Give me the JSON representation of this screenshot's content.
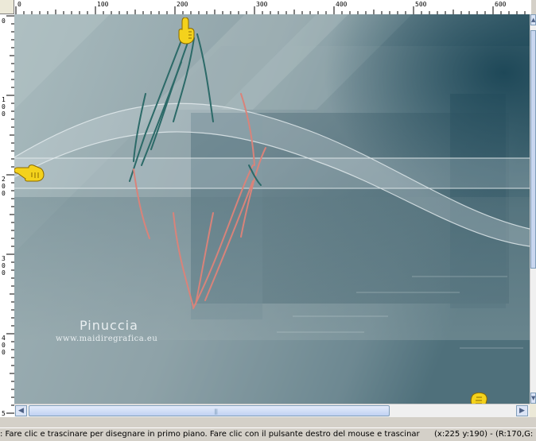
{
  "ruler_top": {
    "labels": [
      "0",
      "100",
      "200",
      "300",
      "400",
      "500",
      "600"
    ]
  },
  "ruler_left": {
    "labels": [
      "0",
      "1 0 0",
      "2 0 0",
      "3 0 0",
      "4 0 0",
      "5"
    ]
  },
  "watermark": {
    "title": "Pinuccia",
    "url": "www.maidiregrafica.eu"
  },
  "scrollbars": {
    "grip": "|||"
  },
  "status": {
    "message": ": Fare clic e trascinare per disegnare in primo piano. Fare clic con il pulsante destro del mouse e trascinare per c",
    "coords": "(x:225 y:190) - (R:170,G:"
  },
  "colors": {
    "canvas_base": "#8aa0a6",
    "dark_teal": "#2d5563",
    "stroke_teal": "#2c6a68",
    "stroke_salmon": "#d9837a",
    "hand": "#f4d21c"
  },
  "icons": [
    "pointing-hand-icon",
    "scroll-left-arrow-icon",
    "scroll-right-arrow-icon",
    "scroll-up-arrow-icon",
    "scroll-down-arrow-icon"
  ]
}
